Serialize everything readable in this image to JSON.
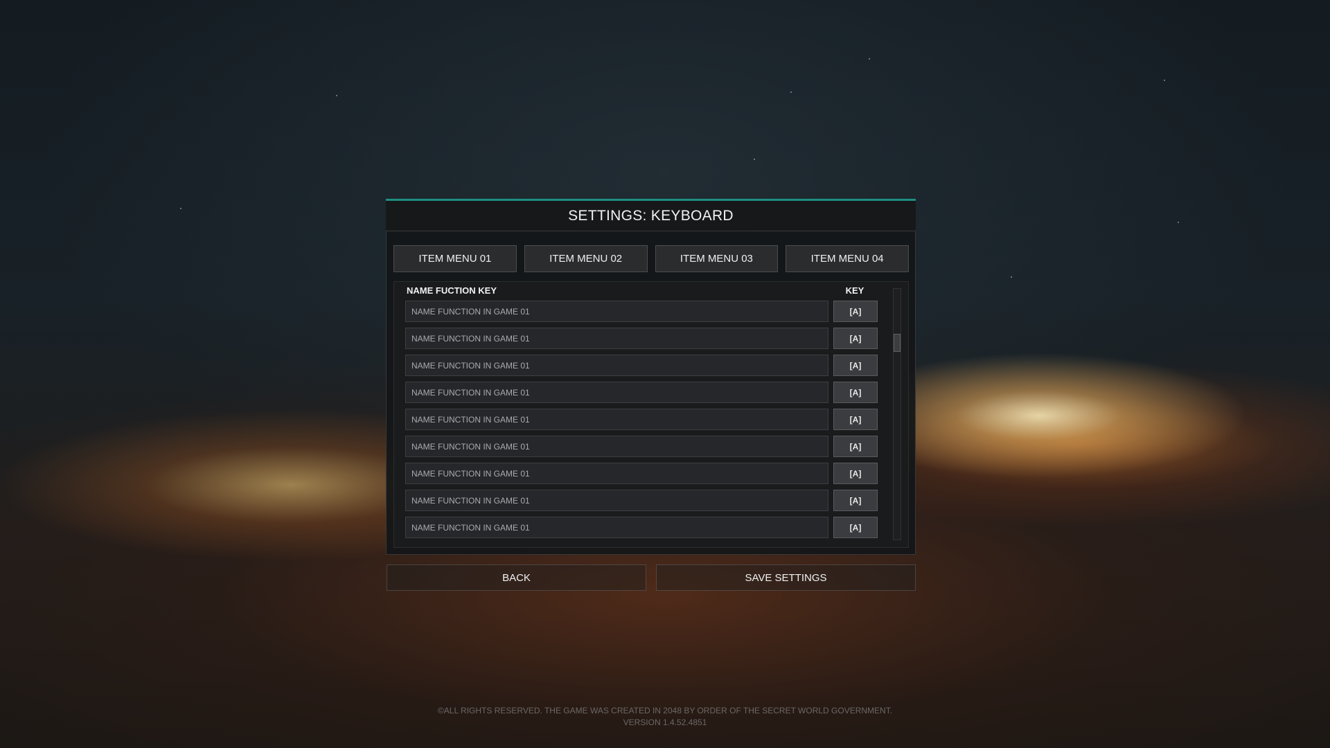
{
  "settings": {
    "title": "SETTINGS: KEYBOARD"
  },
  "tabs": [
    {
      "label": "ITEM MENU 01"
    },
    {
      "label": "ITEM MENU 02"
    },
    {
      "label": "ITEM MENU 03"
    },
    {
      "label": "ITEM MENU 04"
    }
  ],
  "table": {
    "header_name": "NAME FUCTION KEY",
    "header_key": "KEY",
    "rows": [
      {
        "name": "NAME FUNCTION IN GAME 01",
        "key": "[A]"
      },
      {
        "name": "NAME FUNCTION IN GAME 01",
        "key": "[A]"
      },
      {
        "name": "NAME FUNCTION IN GAME 01",
        "key": "[A]"
      },
      {
        "name": "NAME FUNCTION IN GAME 01",
        "key": "[A]"
      },
      {
        "name": "NAME FUNCTION IN GAME 01",
        "key": "[A]"
      },
      {
        "name": "NAME FUNCTION IN GAME 01",
        "key": "[A]"
      },
      {
        "name": "NAME FUNCTION IN GAME 01",
        "key": "[A]"
      },
      {
        "name": "NAME FUNCTION IN GAME 01",
        "key": "[A]"
      },
      {
        "name": "NAME FUNCTION IN GAME 01",
        "key": "[A]"
      }
    ]
  },
  "buttons": {
    "back": "BACK",
    "save": "SAVE SETTINGS"
  },
  "footer": {
    "copyright": "©ALL RIGHTS RESERVED. THE GAME WAS CREATED IN 2048 BY ORDER OF THE SECRET WORLD GOVERNMENT.",
    "version": "VERSION 1.4.52.4851"
  },
  "colors": {
    "accent": "#1f8f82"
  }
}
